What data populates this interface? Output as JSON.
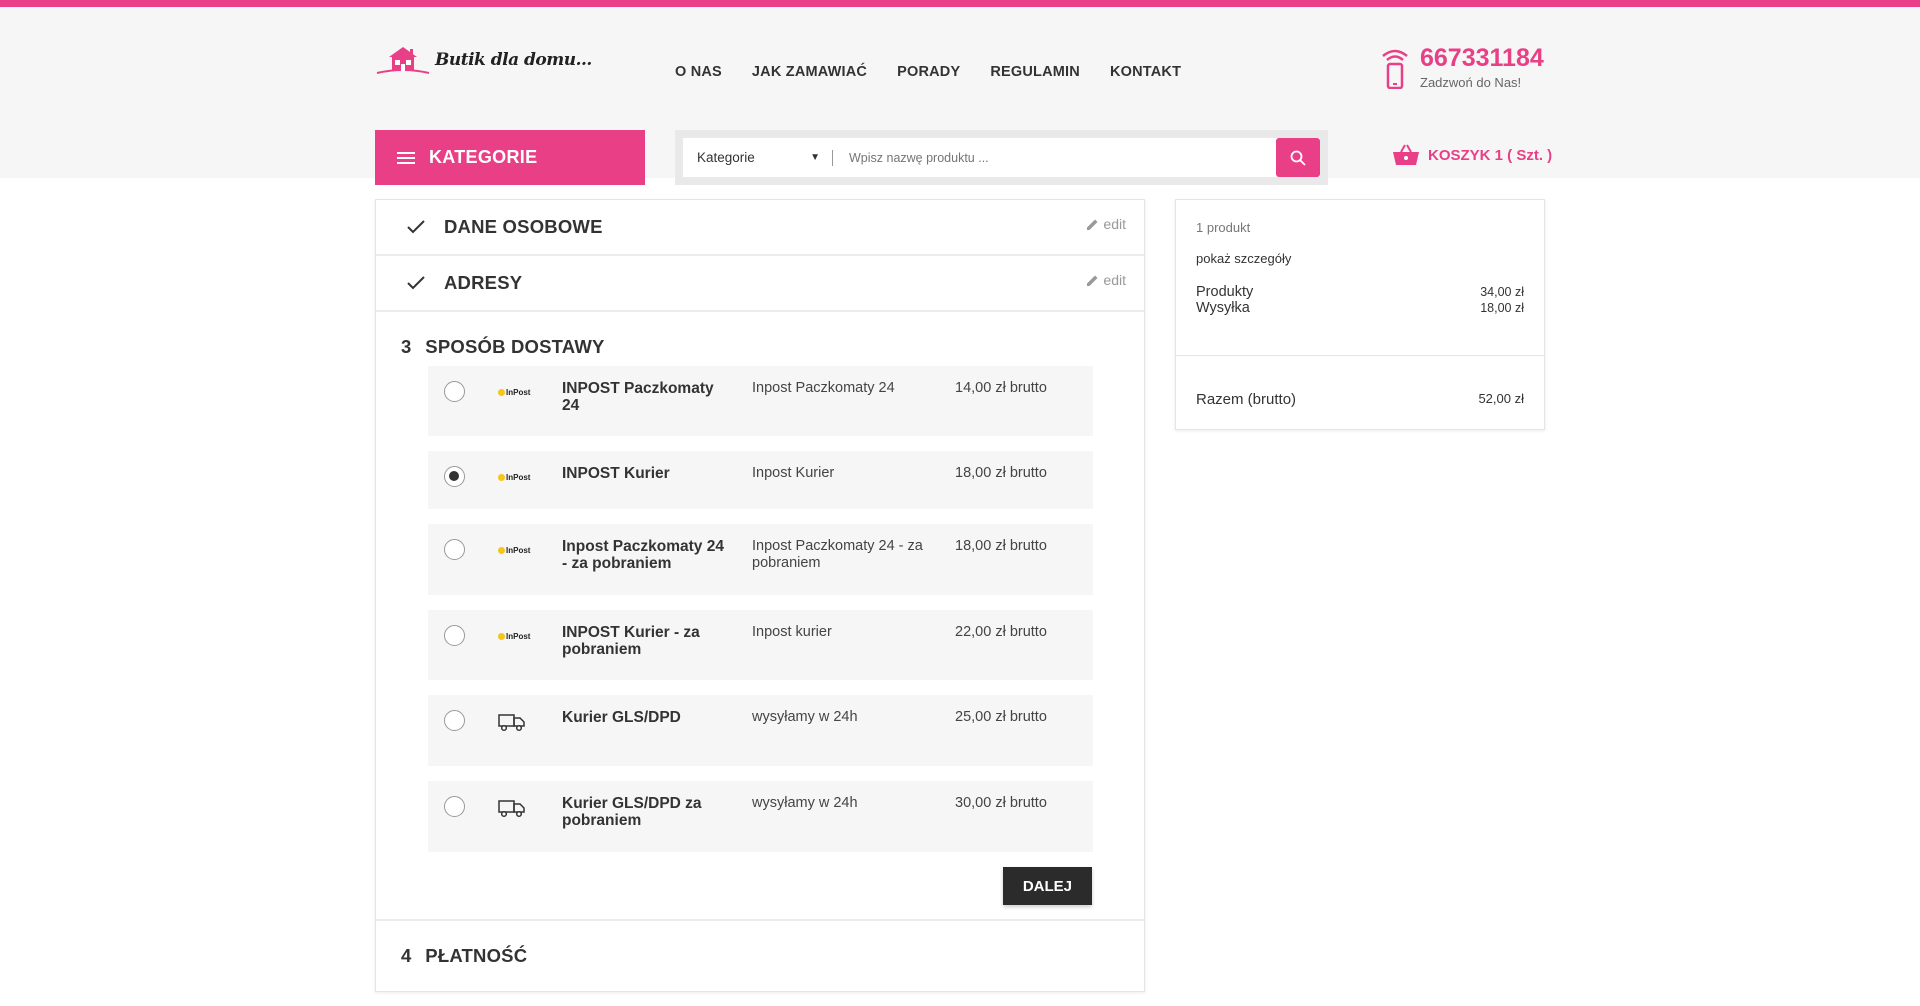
{
  "colors": {
    "accent": "#e93f86",
    "dark_button": "#2b2b2b",
    "row_bg": "#f6f6f6"
  },
  "header": {
    "logo_text": "Butik dla domu...",
    "nav": [
      "O NAS",
      "JAK ZAMAWIAĆ",
      "PORADY",
      "REGULAMIN",
      "KONTAKT"
    ],
    "phone_number": "667331184",
    "phone_sub": "Zadzwoń do Nas!",
    "categories_button": "KATEGORIE",
    "search_select": "Kategorie",
    "search_placeholder": "Wpisz nazwę produktu ...",
    "cart_label": "KOSZYK 1 ( Szt. )"
  },
  "checkout": {
    "step1": {
      "title": "DANE OSOBOWE",
      "edit": "edit"
    },
    "step2": {
      "title": "ADRESY",
      "edit": "edit"
    },
    "step3": {
      "number": "3",
      "title": "SPOSÓB DOSTAWY",
      "carriers": [
        {
          "name": "INPOST Paczkomaty 24",
          "desc": "Inpost Paczkomaty 24",
          "price": "14,00 zł brutto",
          "logo": "InPost",
          "selected": false
        },
        {
          "name": "INPOST Kurier",
          "desc": "Inpost Kurier",
          "price": "18,00 zł brutto",
          "logo": "InPost",
          "selected": true
        },
        {
          "name": "Inpost Paczkomaty 24 - za pobraniem",
          "desc": "Inpost Paczkomaty 24 - za pobraniem",
          "price": "18,00 zł brutto",
          "logo": "InPost",
          "selected": false
        },
        {
          "name": "INPOST Kurier - za pobraniem",
          "desc": "Inpost kurier",
          "price": "22,00 zł brutto",
          "logo": "InPost",
          "selected": false
        },
        {
          "name": "Kurier GLS/DPD",
          "desc": "wysyłamy w 24h",
          "price": "25,00 zł brutto",
          "logo": "truck-icon",
          "selected": false
        },
        {
          "name": "Kurier GLS/DPD za pobraniem",
          "desc": "wysyłamy w 24h",
          "price": "30,00 zł brutto",
          "logo": "truck-icon",
          "selected": false
        }
      ],
      "next_button": "DALEJ"
    },
    "step4": {
      "number": "4",
      "title": "PŁATNOŚĆ"
    }
  },
  "summary": {
    "count": "1 produkt",
    "details_link": "pokaż szczegóły",
    "products_label": "Produkty",
    "products_value": "34,00 zł",
    "shipping_label": "Wysyłka",
    "shipping_value": "18,00 zł",
    "total_label": "Razem (brutto)",
    "total_value": "52,00 zł"
  }
}
